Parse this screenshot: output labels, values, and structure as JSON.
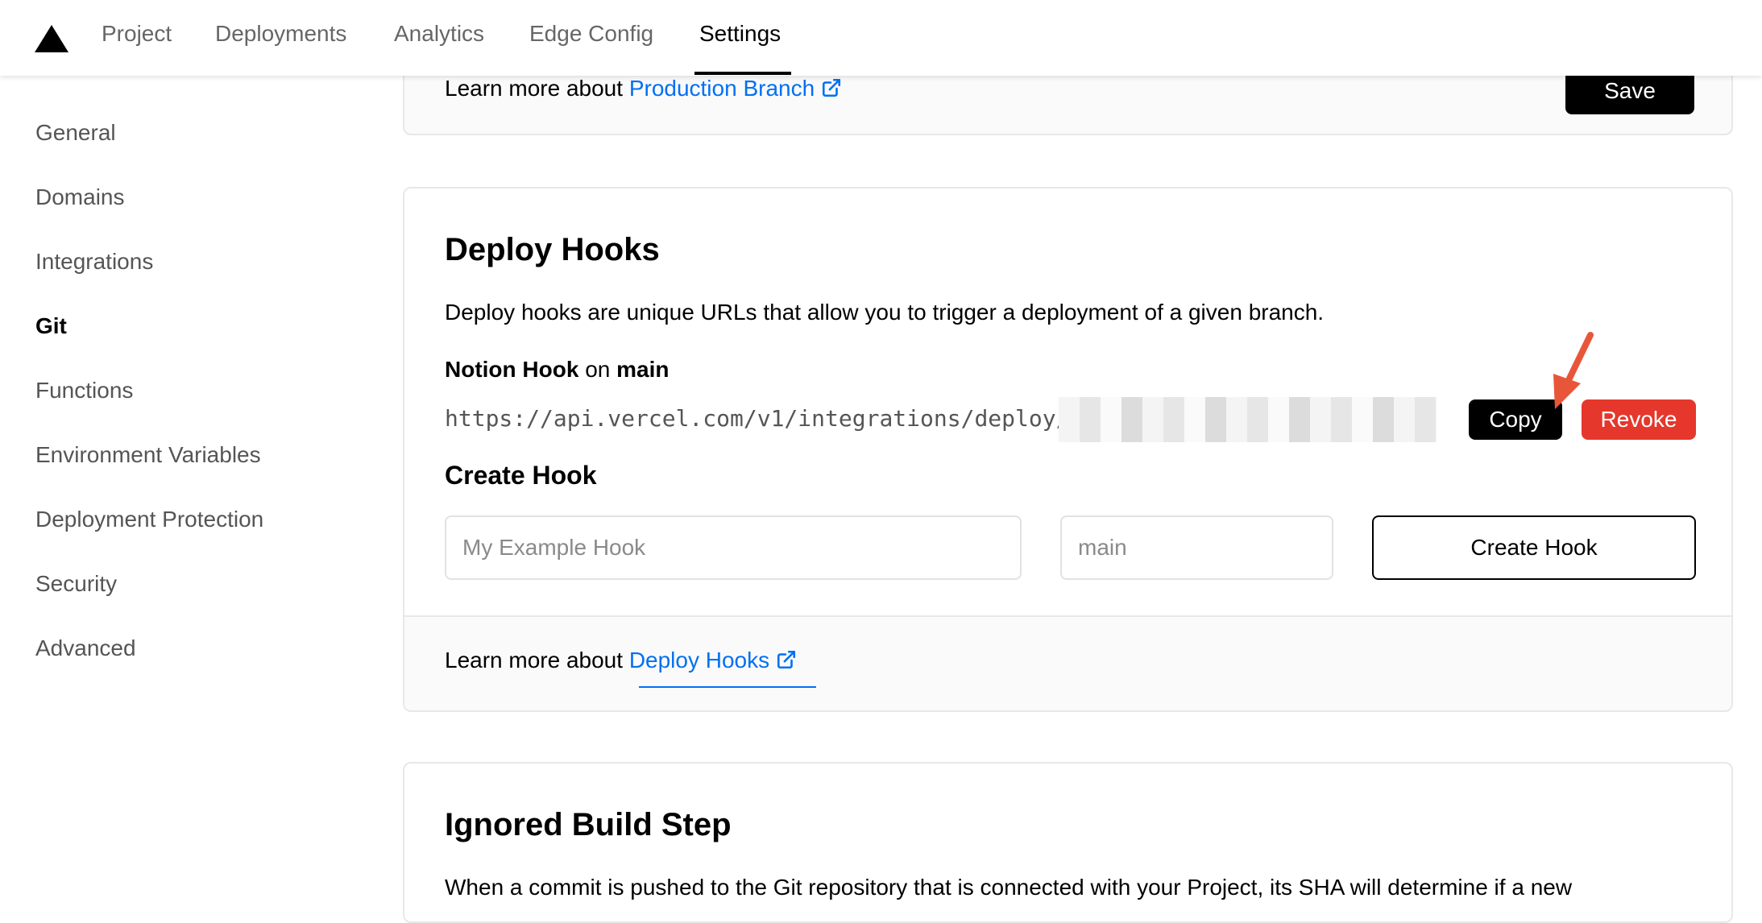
{
  "topnav": {
    "tabs": [
      {
        "label": "Project"
      },
      {
        "label": "Deployments"
      },
      {
        "label": "Analytics"
      },
      {
        "label": "Edge Config"
      },
      {
        "label": "Settings"
      }
    ],
    "active_tab": "Settings"
  },
  "sidebar": {
    "items": [
      {
        "label": "General"
      },
      {
        "label": "Domains"
      },
      {
        "label": "Integrations"
      },
      {
        "label": "Git"
      },
      {
        "label": "Functions"
      },
      {
        "label": "Environment Variables"
      },
      {
        "label": "Deployment Protection"
      },
      {
        "label": "Security"
      },
      {
        "label": "Advanced"
      }
    ],
    "active_item": "Git"
  },
  "production_branch_card": {
    "learn_more_prefix": "Learn more about ",
    "learn_more_link": "Production Branch",
    "save_label": "Save"
  },
  "deploy_hooks_card": {
    "title": "Deploy Hooks",
    "description": "Deploy hooks are unique URLs that allow you to trigger a deployment of a given branch.",
    "hook": {
      "name": "Notion Hook",
      "on_word": "on",
      "branch": "main",
      "url": "https://api.vercel.com/v1/integrations/deploy/",
      "copy_label": "Copy",
      "revoke_label": "Revoke"
    },
    "create_hook": {
      "title": "Create Hook",
      "name_placeholder": "My Example Hook",
      "branch_placeholder": "main",
      "button_label": "Create Hook"
    },
    "learn_more_prefix": "Learn more about ",
    "learn_more_link": "Deploy Hooks"
  },
  "ignored_build_step_card": {
    "title": "Ignored Build Step",
    "description": "When a commit is pushed to the Git repository that is connected with your Project, its SHA will determine if a new"
  },
  "colors": {
    "link": "#0070f3",
    "danger": "#e5372b",
    "primary": "#000000",
    "annotation_arrow": "#e8563a"
  },
  "icons": {
    "logo": "triangle-logo-icon",
    "external_link": "external-link-icon",
    "annotation": "arrow-pointer-icon"
  }
}
